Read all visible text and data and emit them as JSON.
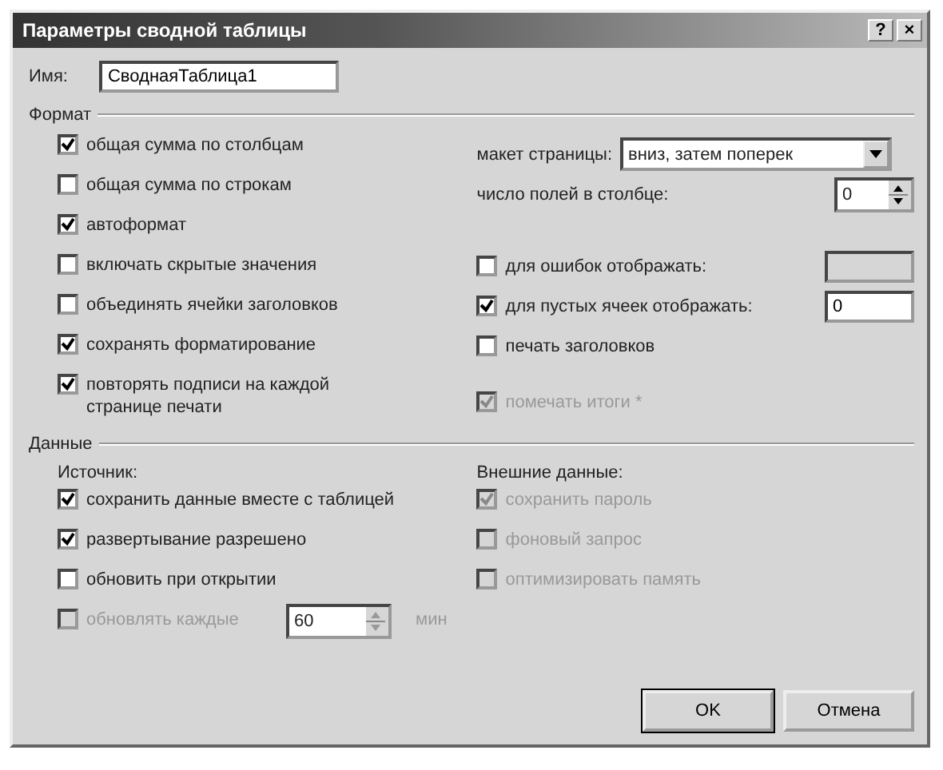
{
  "window": {
    "title": "Параметры сводной таблицы",
    "help_button": "?",
    "close_button": "×"
  },
  "name": {
    "label": "Имя:",
    "value": "СводнаяТаблица1"
  },
  "format": {
    "title": "Формат",
    "options": [
      {
        "label": "общая сумма по столбцам",
        "checked": true,
        "disabled": false
      },
      {
        "label": "общая сумма по строкам",
        "checked": false,
        "disabled": false
      },
      {
        "label": "автоформат",
        "checked": true,
        "disabled": false
      },
      {
        "label": "включать скрытые значения",
        "checked": false,
        "disabled": false
      },
      {
        "label": "объединять ячейки заголовков",
        "checked": false,
        "disabled": false
      },
      {
        "label": "сохранять форматирование",
        "checked": true,
        "disabled": false
      },
      {
        "label": "повторять подписи на каждой странице печати",
        "checked": true,
        "disabled": false
      }
    ],
    "page_layout": {
      "label": "макет страницы:",
      "value": "вниз, затем поперек"
    },
    "fields_per_column": {
      "label": "число полей в столбце:",
      "value": "0"
    },
    "for_errors": {
      "label": "для ошибок отображать:",
      "checked": false,
      "field_disabled": true
    },
    "for_empty": {
      "label": "для пустых ячеек отображать:",
      "checked": true,
      "field_disabled": false,
      "value": "0"
    },
    "more": [
      {
        "label": "печать заголовков",
        "checked": false,
        "disabled": false
      },
      {
        "label": "помечать итоги *",
        "checked": true,
        "disabled": true
      }
    ]
  },
  "data": {
    "title": "Данные",
    "source": {
      "title": "Источник:",
      "options": [
        {
          "label": "сохранить данные вместе с таблицей",
          "checked": true,
          "disabled": false
        },
        {
          "label": "развертывание разрешено",
          "checked": true,
          "disabled": false
        },
        {
          "label": "обновить при открытии",
          "checked": false,
          "disabled": false
        }
      ],
      "refresh": {
        "label": "обновлять каждые",
        "checked": false,
        "disabled": true,
        "value": "60",
        "unit": "мин"
      }
    },
    "external": {
      "title": "Внешние данные:",
      "options": [
        {
          "label": "сохранить пароль",
          "checked": true,
          "disabled": true
        },
        {
          "label": "фоновый запрос",
          "checked": false,
          "disabled": true
        },
        {
          "label": "оптимизировать память",
          "checked": false,
          "disabled": true
        }
      ]
    }
  },
  "buttons": [
    {
      "label": "OK",
      "default": true
    },
    {
      "label": "Отмена",
      "default": false
    }
  ]
}
